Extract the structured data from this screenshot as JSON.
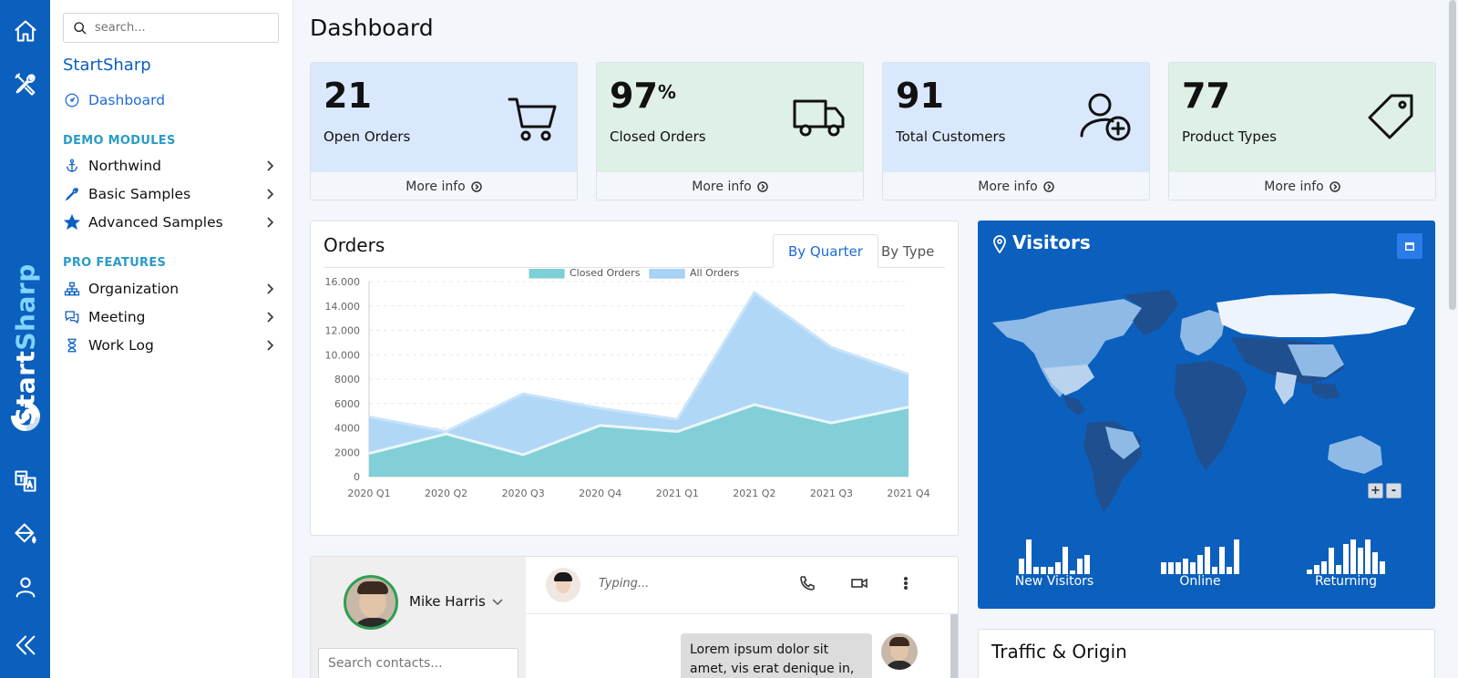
{
  "rail": {
    "brand_part1": "Start",
    "brand_part2": "Sharp",
    "icons": [
      "home-icon",
      "tools-icon",
      "translate-icon",
      "paint-bucket-icon",
      "user-icon",
      "collapse-icon"
    ]
  },
  "sidebar": {
    "search_placeholder": "search...",
    "title": "StartSharp",
    "dashboard": "Dashboard",
    "section_demo": "DEMO MODULES",
    "demo_items": [
      "Northwind",
      "Basic Samples",
      "Advanced Samples"
    ],
    "section_pro": "PRO FEATURES",
    "pro_items": [
      "Organization",
      "Meeting",
      "Work Log"
    ]
  },
  "page": {
    "title": "Dashboard"
  },
  "cards": [
    {
      "value": "21",
      "suffix": "",
      "label": "Open Orders",
      "more": "More info",
      "bg": "#d9e8fd",
      "icon": "cart-icon"
    },
    {
      "value": "97",
      "suffix": "%",
      "label": "Closed Orders",
      "more": "More info",
      "bg": "#dff0e6",
      "icon": "truck-icon"
    },
    {
      "value": "91",
      "suffix": "",
      "label": "Total Customers",
      "more": "More info",
      "bg": "#d9e8fd",
      "icon": "add-user-icon"
    },
    {
      "value": "77",
      "suffix": "",
      "label": "Product Types",
      "more": "More info",
      "bg": "#dff0e6",
      "icon": "tag-icon"
    }
  ],
  "orders": {
    "title": "Orders",
    "tab_quarter": "By Quarter",
    "tab_type": "By Type"
  },
  "chart_data": {
    "type": "area",
    "categories": [
      "2020 Q1",
      "2020 Q2",
      "2020 Q3",
      "2020 Q4",
      "2021 Q1",
      "2021 Q2",
      "2021 Q3",
      "2021 Q4"
    ],
    "series": [
      {
        "name": "Closed Orders",
        "values": [
          1900,
          3500,
          1800,
          4200,
          3700,
          5900,
          4400,
          5700
        ],
        "color": "#7fcfd6"
      },
      {
        "name": "All Orders",
        "values": [
          4900,
          3700,
          6800,
          5600,
          4700,
          15100,
          10600,
          8400
        ],
        "color": "#a9d3f6"
      }
    ],
    "ylim": [
      0,
      16000
    ],
    "yticks": [
      "0",
      "2000",
      "4000",
      "6000",
      "8000",
      "10.000",
      "12.000",
      "14.000",
      "16.000"
    ],
    "legend": "top",
    "grid": true
  },
  "visitors": {
    "title": "Visitors",
    "zoom_in": "+",
    "zoom_out": "-",
    "sparks": [
      {
        "label": "New Visitors",
        "values": [
          4,
          9,
          2,
          2,
          2,
          3,
          7,
          1,
          4,
          5
        ]
      },
      {
        "label": "Online",
        "values": [
          3,
          3,
          3,
          4,
          3,
          5,
          7,
          2,
          7,
          2,
          9
        ]
      },
      {
        "label": "Returning",
        "values": [
          1,
          2,
          3,
          6,
          2,
          7,
          8,
          6,
          8,
          5,
          3
        ]
      }
    ]
  },
  "chat": {
    "user": "Mike Harris",
    "contacts_placeholder": "Search contacts...",
    "typing": "Typing...",
    "message": "Lorem ipsum dolor sit amet, vis erat denique in,"
  },
  "traffic": {
    "title": "Traffic & Origin"
  }
}
